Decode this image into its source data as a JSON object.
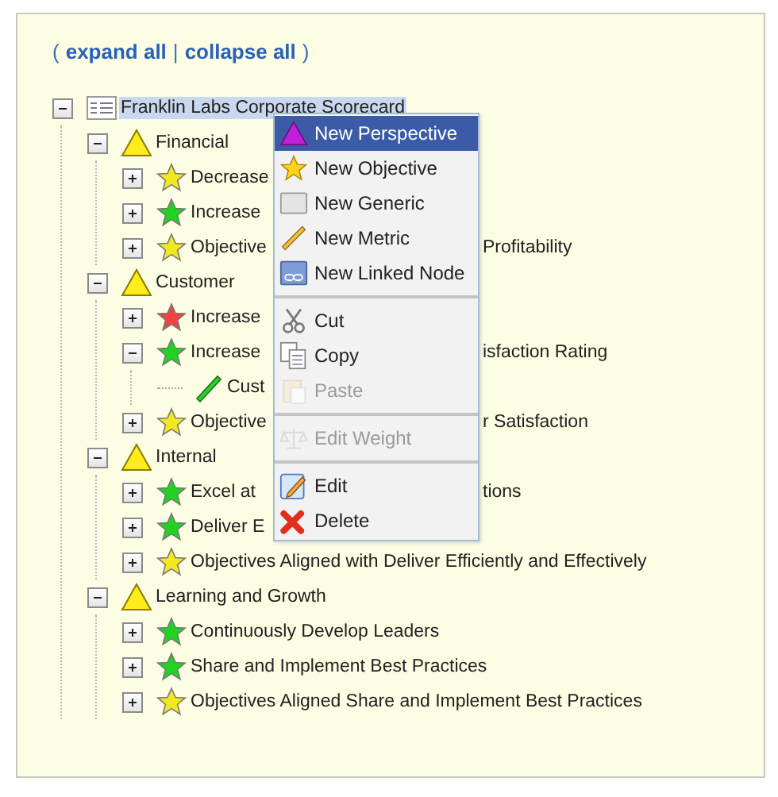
{
  "toolbar": {
    "open": "(",
    "links": [
      {
        "label": "expand all"
      },
      {
        "label": "collapse all"
      }
    ],
    "separator": "|",
    "close": ")"
  },
  "tree": [
    {
      "kind": "scorecard",
      "label": "Franklin Labs Corporate Scorecard",
      "selected": true,
      "expanded": true,
      "children": [
        {
          "kind": "perspective",
          "label": "Financial",
          "selected": false,
          "expanded": true,
          "children": [
            {
              "kind": "objective",
              "color": "#f2e820",
              "label": "Decrease",
              "selected": false,
              "expanded": false
            },
            {
              "kind": "objective",
              "color": "#22d222",
              "label": "Increase",
              "selected": false,
              "expanded": false
            },
            {
              "kind": "objective",
              "color": "#f2e820",
              "label": "Objective",
              "tail": "Profitability",
              "selected": false,
              "expanded": false
            }
          ]
        },
        {
          "kind": "perspective",
          "label": "Customer",
          "selected": false,
          "expanded": true,
          "children": [
            {
              "kind": "objective",
              "color": "#ee4444",
              "label": "Increase",
              "selected": false,
              "expanded": false
            },
            {
              "kind": "objective",
              "color": "#22d222",
              "label": "Increase",
              "tail": "isfaction Rating",
              "selected": false,
              "expanded": true,
              "children": [
                {
                  "kind": "metric",
                  "label": "Cust",
                  "selected": false
                }
              ]
            },
            {
              "kind": "objective",
              "color": "#f2e820",
              "label": "Objective",
              "tail": "r Satisfaction",
              "selected": false,
              "expanded": false
            }
          ]
        },
        {
          "kind": "perspective",
          "label": "Internal",
          "selected": false,
          "expanded": true,
          "children": [
            {
              "kind": "objective",
              "color": "#22d222",
              "label": "Excel at",
              "tail": "tions",
              "selected": false,
              "expanded": false
            },
            {
              "kind": "objective",
              "color": "#22d222",
              "label": "Deliver E",
              "selected": false,
              "expanded": false
            },
            {
              "kind": "objective",
              "color": "#f2e820",
              "label": "Objectives Aligned with Deliver Efficiently and Effectively",
              "selected": false,
              "expanded": false
            }
          ]
        },
        {
          "kind": "perspective",
          "label": "Learning and Growth",
          "selected": false,
          "expanded": true,
          "children": [
            {
              "kind": "objective",
              "color": "#22d222",
              "label": "Continuously Develop Leaders",
              "selected": false,
              "expanded": false
            },
            {
              "kind": "objective",
              "color": "#22d222",
              "label": "Share and Implement Best Practices",
              "selected": false,
              "expanded": false
            },
            {
              "kind": "objective",
              "color": "#f2e820",
              "label": "Objectives Aligned Share and Implement Best Practices",
              "selected": false,
              "expanded": false
            }
          ]
        }
      ]
    }
  ],
  "context_menu": {
    "groups": [
      [
        {
          "kind": "perspective",
          "label": "New Perspective",
          "selected": true,
          "disabled": false
        },
        {
          "kind": "objective",
          "label": "New Objective",
          "selected": false,
          "disabled": false
        },
        {
          "kind": "generic",
          "label": "New Generic",
          "selected": false,
          "disabled": false
        },
        {
          "kind": "metric",
          "label": "New Metric",
          "selected": false,
          "disabled": false
        },
        {
          "kind": "linked",
          "label": "New Linked Node",
          "selected": false,
          "disabled": false
        }
      ],
      [
        {
          "kind": "cut",
          "label": "Cut",
          "selected": false,
          "disabled": false
        },
        {
          "kind": "copy",
          "label": "Copy",
          "selected": false,
          "disabled": false
        },
        {
          "kind": "paste",
          "label": "Paste",
          "selected": false,
          "disabled": true
        }
      ],
      [
        {
          "kind": "weight",
          "label": "Edit Weight",
          "selected": false,
          "disabled": true
        }
      ],
      [
        {
          "kind": "edit",
          "label": "Edit",
          "selected": false,
          "disabled": false
        },
        {
          "kind": "delete",
          "label": "Delete",
          "selected": false,
          "disabled": false
        }
      ]
    ]
  }
}
